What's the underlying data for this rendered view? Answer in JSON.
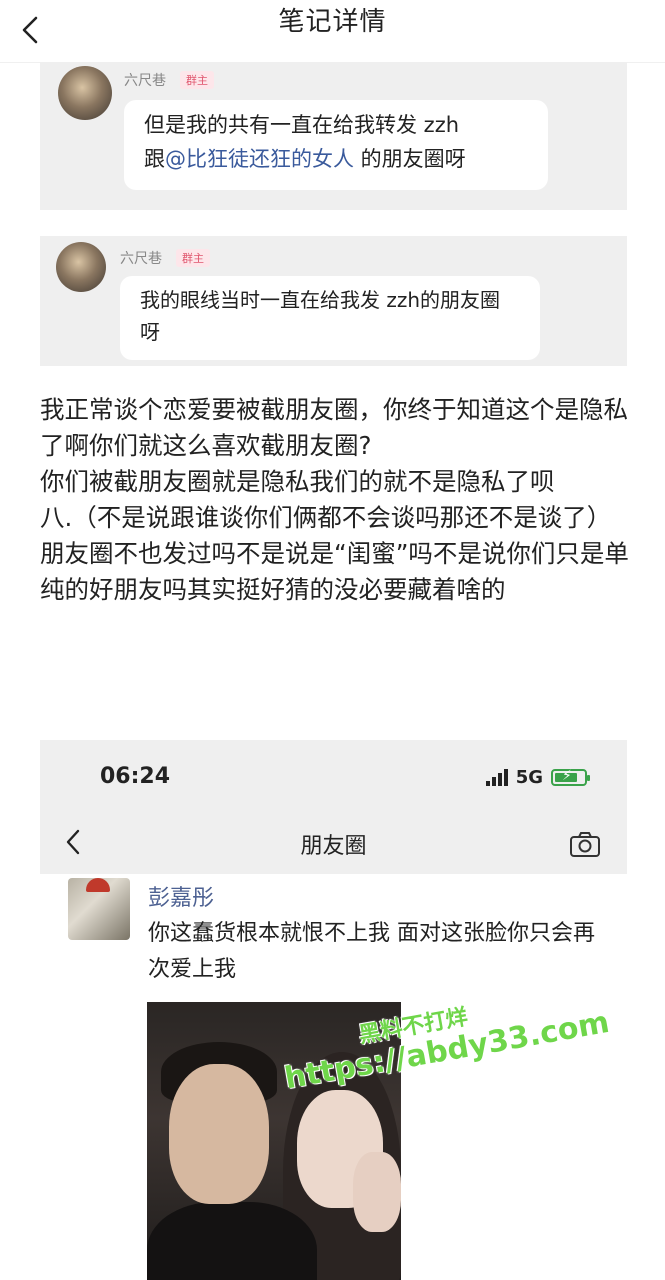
{
  "header": {
    "title": "笔记详情",
    "back_icon": "chevron-left-icon"
  },
  "screenshot1": {
    "username": "六尺巷",
    "badge": "群主",
    "message_part1": "但是我的共有一直在给我转发 zzh",
    "message_part2": "跟",
    "mention": "@比狂徒还狂的女人",
    "message_part3": " 的朋友圈呀"
  },
  "screenshot2": {
    "username": "六尺巷",
    "badge": "群主",
    "message": "我的眼线当时一直在给我发 zzh的朋友圈呀"
  },
  "post": {
    "paragraphs": [
      "我正常谈个恋爱要被截朋友圈，你终于知道这个是隐私了啊你们就这么喜欢截朋友圈?",
      "你们被截朋友圈就是隐私我们的就不是隐私了呗",
      "八.（不是说跟谁谈你们俩都不会谈吗那还不是谈了）朋友圈不也发过吗不是说是“闺蜜”吗不是说你们只是单纯的好朋友吗其实挺好猜的没必要藏着啥的"
    ]
  },
  "moments_screenshot": {
    "status_time": "06:24",
    "network": "5G",
    "battery_level": 0.7,
    "page_title": "朋友圈",
    "back_icon": "chevron-left-icon",
    "camera_icon": "camera-icon",
    "author": "彭嘉彤",
    "text": "你这蠢货根本就恨不上我 面对这张脸你只会再次爱上我"
  },
  "watermark": {
    "line1": "黑料不打烊",
    "line2": "https://abdy33.com"
  }
}
